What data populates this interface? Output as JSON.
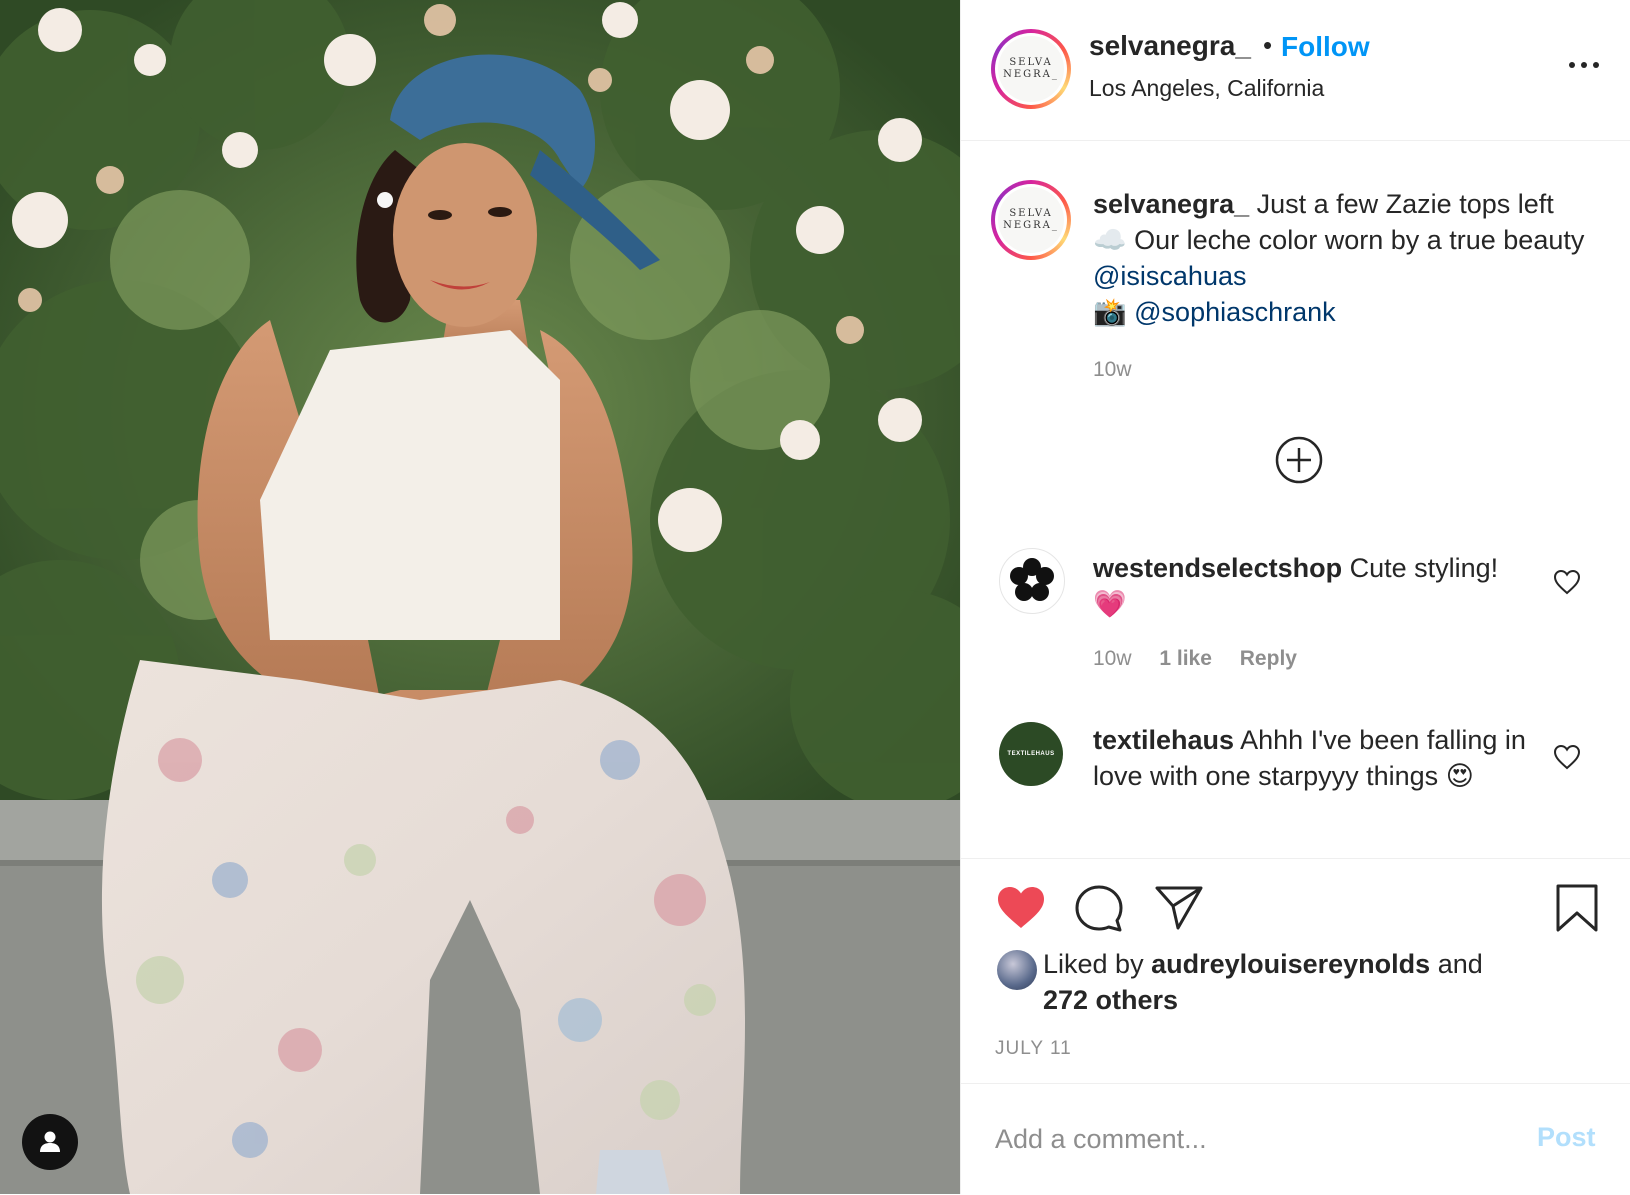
{
  "post": {
    "username": "selvanegra_",
    "follow_label": "Follow",
    "separator": "•",
    "location": "Los Angeles, California",
    "avatar_text_line1": "SELVA",
    "avatar_text_line2": "NEGRA_"
  },
  "caption": {
    "username": "selvanegra_",
    "text_part1": " Just a few Zazie tops left ",
    "emoji_cloud": "☁️",
    "text_part2": " Our leche color worn by a true beauty ",
    "mention1": "@isiscahuas",
    "emoji_camera": "📸",
    "mention2": "@sophiaschrank",
    "time": "10w"
  },
  "comments": [
    {
      "username": "westendselectshop",
      "text": " Cute styling! ",
      "emoji": "💗",
      "time": "10w",
      "likes": "1 like",
      "reply_label": "Reply"
    },
    {
      "username": "textilehaus",
      "text": " Ahhh I've been falling in love with one starpyyy things ",
      "emoji": "😍",
      "avatar_text": "TEXTILEHAUS"
    }
  ],
  "likes": {
    "prefix": "Liked by ",
    "user": "audreylouisereynolds",
    "middle": " and",
    "others": "272 others"
  },
  "date": "JULY 11",
  "comment_box": {
    "placeholder": "Add a comment...",
    "post_label": "Post"
  },
  "icons": {
    "like": "heart-filled-icon",
    "comment": "comment-bubble-icon",
    "share": "paper-plane-icon",
    "save": "bookmark-icon",
    "more": "ellipsis-icon",
    "add": "plus-circle-icon",
    "tag": "user-tag-icon"
  },
  "colors": {
    "accent": "#0095f6",
    "like": "#ed4956",
    "mention": "#00376b",
    "muted": "#8e8e8e"
  }
}
